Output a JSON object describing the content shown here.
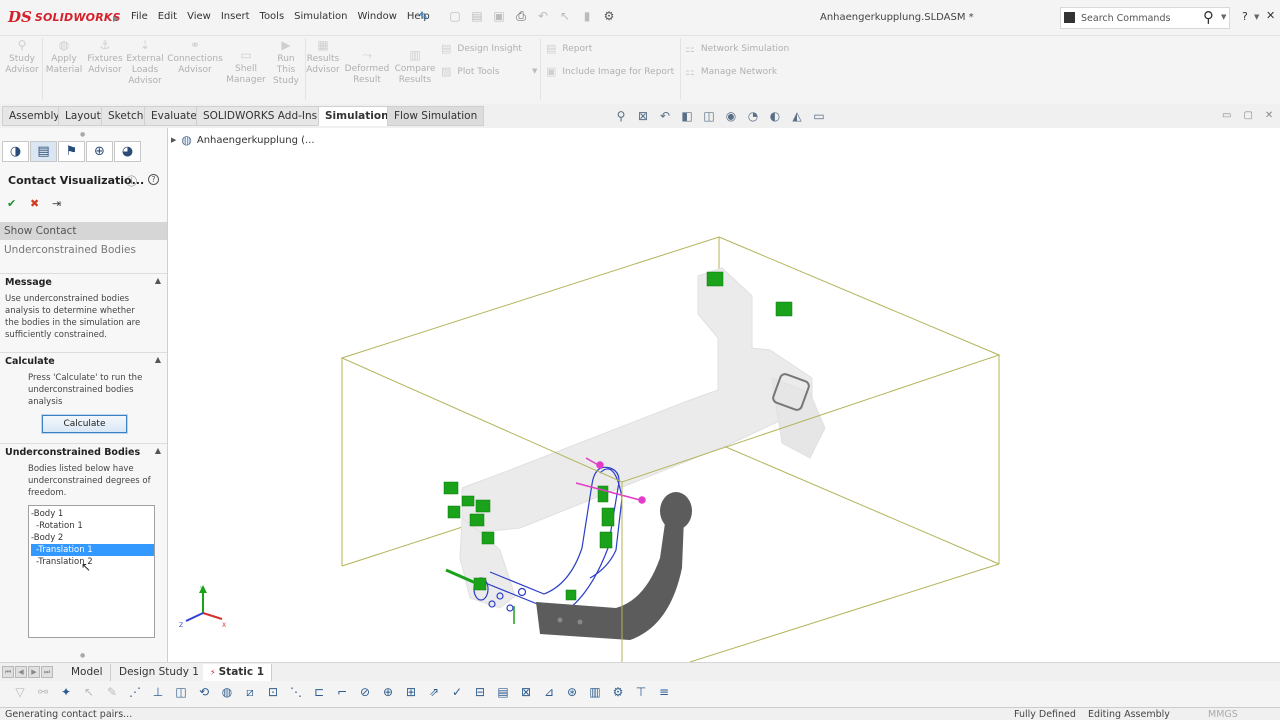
{
  "app": {
    "brand": "SOLIDWORKS",
    "logo_mark": "DS",
    "document_title": "Anhaengerkupplung.SLDASM *"
  },
  "menu": [
    "File",
    "Edit",
    "View",
    "Insert",
    "Tools",
    "Simulation",
    "Window",
    "Help"
  ],
  "search": {
    "placeholder": "Search Commands"
  },
  "help_label": "?",
  "command_manager": {
    "big_tools": [
      {
        "id": "study-advisor",
        "label": "Study\nAdvisor"
      },
      {
        "id": "apply-material",
        "label": "Apply\nMaterial"
      },
      {
        "id": "fixtures-advisor",
        "label": "Fixtures\nAdvisor"
      },
      {
        "id": "external-loads-advisor",
        "label": "External\nLoads\nAdvisor"
      },
      {
        "id": "connections-advisor",
        "label": "Connections\nAdvisor"
      },
      {
        "id": "shell-manager",
        "label": "Shell\nManager"
      },
      {
        "id": "run-this-study",
        "label": "Run\nThis\nStudy"
      },
      {
        "id": "results-advisor",
        "label": "Results\nAdvisor"
      },
      {
        "id": "deformed-result",
        "label": "Deformed\nResult"
      },
      {
        "id": "compare-results",
        "label": "Compare\nResults"
      }
    ],
    "small_tools": {
      "design_insight": "Design Insight",
      "plot_tools": "Plot Tools",
      "report": "Report",
      "include_image": "Include Image for Report",
      "network_simulation": "Network Simulation",
      "manage_network": "Manage Network"
    }
  },
  "tabs": {
    "assembly": "Assembly",
    "layout": "Layout",
    "sketch": "Sketch",
    "evaluate": "Evaluate",
    "addins": "SOLIDWORKS Add-Ins",
    "simulation": "Simulation",
    "flow": "Flow Simulation"
  },
  "property_manager": {
    "title": "Contact Visualizatio...",
    "show_contact": "Show Contact",
    "underconstrained": "Underconstrained Bodies",
    "message_header": "Message",
    "message_text": "Use underconstrained bodies analysis to determine whether the bodies in the simulation are sufficiently constrained.",
    "calculate_header": "Calculate",
    "calculate_text": "Press 'Calculate' to run the underconstrained bodies analysis",
    "calculate_button": "Calculate",
    "bodies_header": "Underconstrained Bodies",
    "bodies_text": "Bodies listed below have underconstrained degrees of freedom.",
    "list": [
      "-Body 1",
      " -Rotation 1",
      "-Body 2",
      " -Translation 1",
      " -Translation 2"
    ],
    "selected_index": 3
  },
  "tree": {
    "root": "Anhaengerkupplung  (..."
  },
  "triad": {
    "x": "X",
    "y": "Y",
    "z": "Z"
  },
  "bottom_tabs": {
    "model": "Model",
    "design_study": "Design Study 1",
    "static": "Static 1"
  },
  "status": {
    "message": "Generating contact pairs...",
    "defined": "Fully Defined",
    "editing": "Editing Assembly",
    "units": "MMGS"
  },
  "colors": {
    "brand_red": "#d4202a",
    "accent_blue": "#3399ff",
    "fixture_green": "#1aa31a",
    "connector_magenta": "#e23cc8",
    "bbox_olive": "#b3b35a"
  }
}
